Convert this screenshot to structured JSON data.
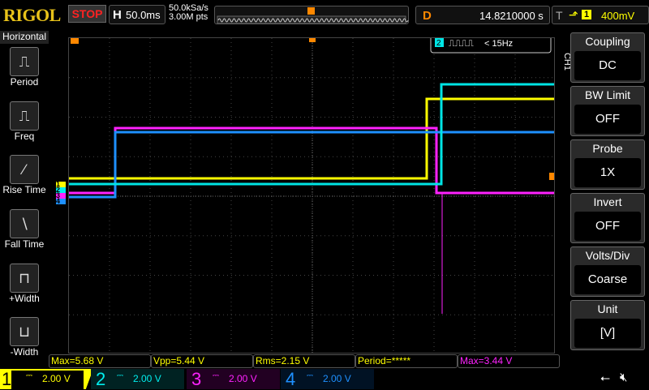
{
  "header": {
    "brand": "RIGOL",
    "run_state": "STOP",
    "h_label": "H",
    "timebase": "50.0ms",
    "sample_rate": "50.0kSa/s",
    "memory_depth": "3.00M pts",
    "delay_label": "D",
    "delay": "14.8210000 s",
    "trigger_label": "T",
    "trigger_edge_icon": "rising-edge",
    "trigger_source": "1",
    "trigger_level": "400mV"
  },
  "left_menu": {
    "title": "Horizontal",
    "items": [
      {
        "label": "Period",
        "icon": "period-icon"
      },
      {
        "label": "Freq",
        "icon": "freq-icon"
      },
      {
        "label": "Rise Time",
        "icon": "rise-time-icon"
      },
      {
        "label": "Fall Time",
        "icon": "fall-time-icon"
      },
      {
        "label": "+Width",
        "icon": "pos-width-icon"
      },
      {
        "label": "-Width",
        "icon": "neg-width-icon"
      }
    ]
  },
  "freq_counter": {
    "channel": "2",
    "value": "< 15Hz"
  },
  "right_menu": {
    "channel_label": "CH1",
    "items": [
      {
        "title": "Coupling",
        "value": "DC"
      },
      {
        "title": "BW Limit",
        "value": "OFF"
      },
      {
        "title": "Probe",
        "value": "1X"
      },
      {
        "title": "Invert",
        "value": "OFF"
      },
      {
        "title": "Volts/Div",
        "value": "Coarse"
      },
      {
        "title": "Unit",
        "value": "[V]"
      }
    ]
  },
  "measurements": [
    {
      "text": "Max=5.68 V",
      "color": "#ffff00"
    },
    {
      "text": "Vpp=5.44 V",
      "color": "#ffff00"
    },
    {
      "text": "Rms=2.15 V",
      "color": "#ffff00"
    },
    {
      "text": "Period=*****",
      "color": "#ffff00"
    },
    {
      "text": "Max=3.44 V",
      "color": "#ff22ff"
    }
  ],
  "channels": [
    {
      "num": "1",
      "scale": "2.00 V",
      "color": "#ffff00"
    },
    {
      "num": "2",
      "scale": "2.00 V",
      "color": "#00e5e5"
    },
    {
      "num": "3",
      "scale": "2.00 V",
      "color": "#ff22ff"
    },
    {
      "num": "4",
      "scale": "2.00 V",
      "color": "#1e90ff"
    }
  ]
}
